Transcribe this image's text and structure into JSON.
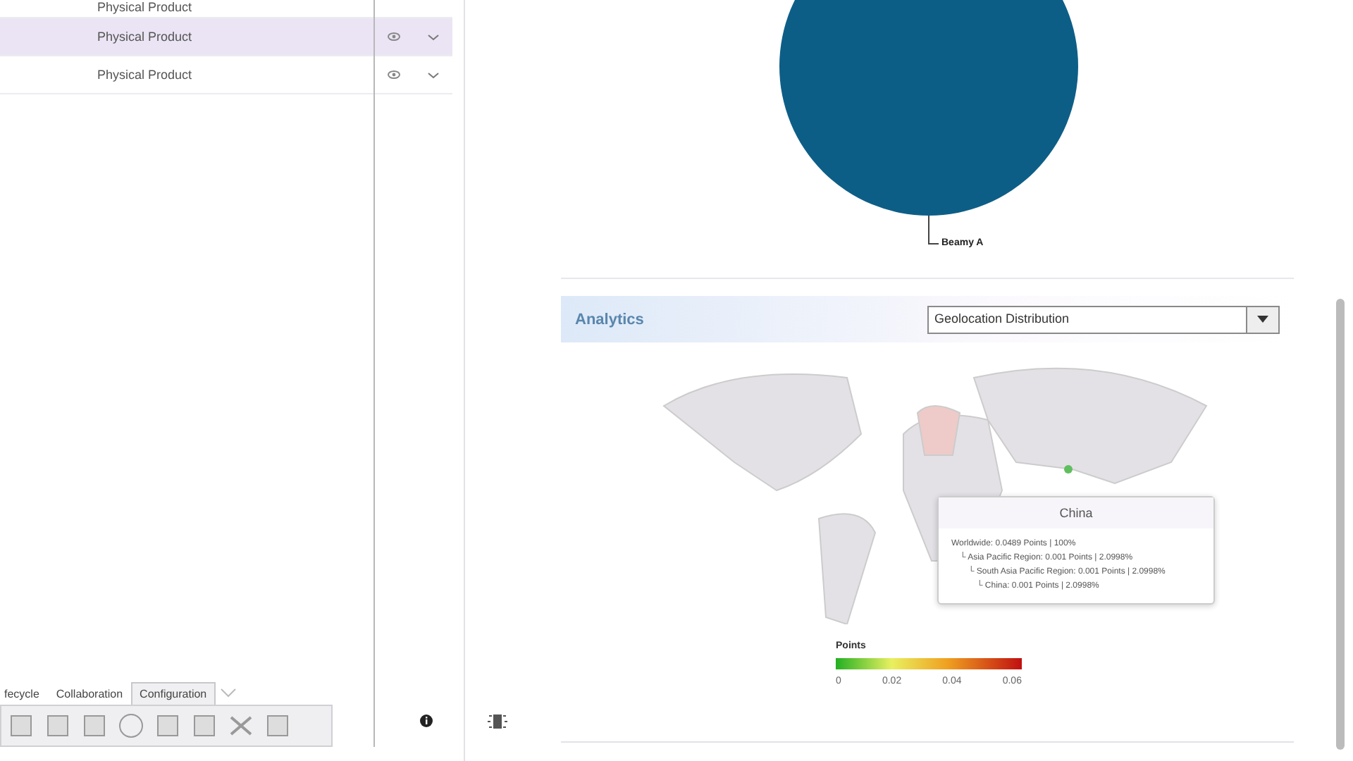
{
  "product_table": {
    "rows": [
      {
        "type": "Physical Product",
        "selected": false,
        "partial": true
      },
      {
        "type": "Physical Product",
        "selected": true,
        "partial": false
      },
      {
        "type": "Physical Product",
        "selected": false,
        "partial": false
      }
    ]
  },
  "toolbar": {
    "tabs": [
      {
        "label": "fecycle",
        "selected": false
      },
      {
        "label": "Collaboration",
        "selected": false
      },
      {
        "label": "Configuration",
        "selected": true
      }
    ]
  },
  "pie_chart": {
    "slice_labels": [
      "Beamy A"
    ]
  },
  "analytics": {
    "title": "Analytics",
    "view_select": {
      "value": "Geolocation Distribution"
    },
    "tooltip": {
      "title": "China",
      "lines": [
        {
          "text": "Worldwide: 0.0489 Points | 100%",
          "children": [
            {
              "text": "└ Asia Pacific Region: 0.001 Points | 2.0998%",
              "children": [
                {
                  "text": "└ South Asia Pacific Region: 0.001 Points | 2.0998%",
                  "children": [
                    {
                      "text": "└ China: 0.001 Points | 2.0998%"
                    }
                  ]
                }
              ]
            }
          ]
        }
      ]
    },
    "legend": {
      "title": "Points",
      "ticks": [
        "0",
        "0.02",
        "0.04",
        "0.06"
      ]
    }
  }
}
